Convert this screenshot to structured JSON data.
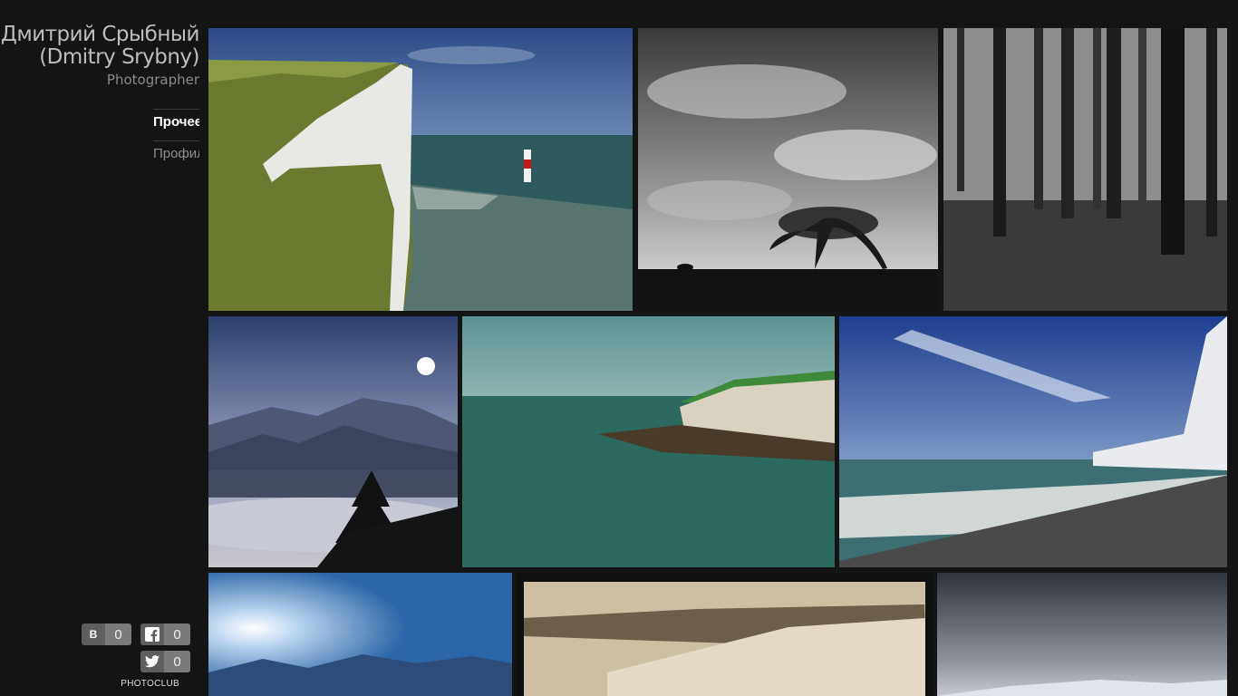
{
  "site": {
    "name_ru": "Дмитрий Срыбный",
    "name_en": "(Dmitry Srybny)",
    "role": "Photographer"
  },
  "nav": [
    {
      "label": "Прочее",
      "active": true
    },
    {
      "label": "Профиль",
      "active": false
    }
  ],
  "social": {
    "vk": {
      "icon": "vk-icon",
      "count": "0"
    },
    "facebook": {
      "icon": "facebook-icon",
      "count": "0"
    },
    "twitter": {
      "icon": "twitter-icon",
      "count": "0"
    },
    "footer_label": "PHOTOCLUB"
  },
  "photos": [
    {
      "subject": "white-cliff-lighthouse"
    },
    {
      "subject": "lone-tree-storm-clouds"
    },
    {
      "subject": "misty-forest"
    },
    {
      "subject": "mountains-sun-fir"
    },
    {
      "subject": "green-sea-cliffs"
    },
    {
      "subject": "waves-pebble-beach-cliffs"
    },
    {
      "subject": "blue-sun-mountains"
    },
    {
      "subject": "snowy-hills-trees"
    },
    {
      "subject": "grey-sky-snowy-mountains"
    }
  ],
  "colors": {
    "background": "#141414",
    "text_active": "#ffffff",
    "text_muted": "#8e8e8e",
    "counter_bg": "#7a7a7a"
  }
}
